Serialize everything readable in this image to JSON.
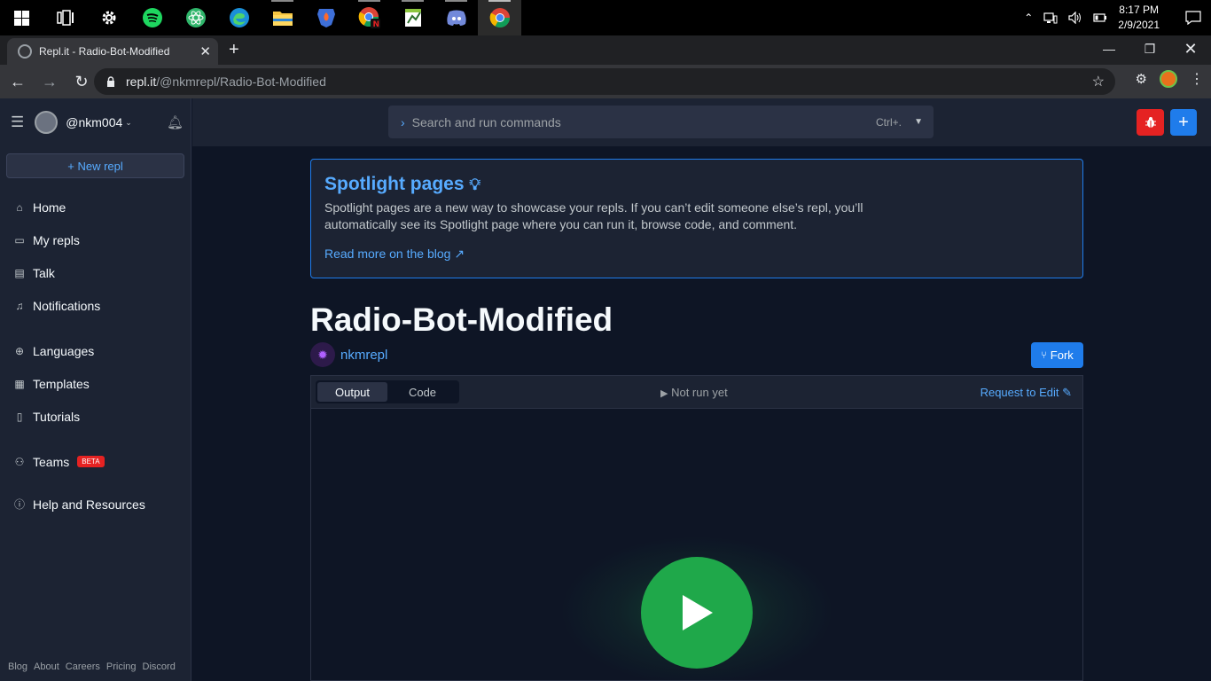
{
  "taskbar": {
    "apps": [
      "windows-start",
      "task-view",
      "settings",
      "spotify",
      "electron-app",
      "edge",
      "file-explorer",
      "brave",
      "chrome-n",
      "notepad",
      "discord",
      "chrome"
    ],
    "time": "8:17 PM",
    "date": "2/9/2021"
  },
  "browser": {
    "tab_title": "Repl.it - Radio-Bot-Modified",
    "url_host": "repl.it",
    "url_path": "/@nkmrepl/Radio-Bot-Modified"
  },
  "sidebar": {
    "username": "@nkm004",
    "new_repl": "+ New repl",
    "items": [
      {
        "label": "Home",
        "icon": "home-icon"
      },
      {
        "label": "My repls",
        "icon": "folder-icon"
      },
      {
        "label": "Talk",
        "icon": "talk-icon"
      },
      {
        "label": "Notifications",
        "icon": "bell-icon"
      },
      {
        "label": "Languages",
        "icon": "globe-icon"
      },
      {
        "label": "Templates",
        "icon": "templates-icon"
      },
      {
        "label": "Tutorials",
        "icon": "book-icon"
      },
      {
        "label": "Teams",
        "icon": "teams-icon",
        "badge": "BETA"
      },
      {
        "label": "Help and Resources",
        "icon": "info-icon"
      }
    ],
    "footer": [
      "Blog",
      "About",
      "Careers",
      "Pricing",
      "Discord"
    ]
  },
  "topbar": {
    "search_placeholder": "Search and run commands",
    "shortcut": "Ctrl+."
  },
  "spotlight": {
    "title": "Spotlight pages",
    "body": "Spotlight pages are a new way to showcase your repls. If you can’t edit someone else’s repl, you’ll automatically see its Spotlight page where you can run it, browse code, and comment.",
    "link": "Read more on the blog ↗"
  },
  "repl": {
    "title": "Radio-Bot-Modified",
    "owner": "nkmrepl",
    "fork": "Fork",
    "tabs": [
      "Output",
      "Code"
    ],
    "status": "Not run yet",
    "request_edit": "Request to Edit"
  },
  "colors": {
    "accent": "#57abff",
    "primary_button": "#1f7ceb",
    "danger": "#e52222",
    "run": "#1fa84a"
  }
}
